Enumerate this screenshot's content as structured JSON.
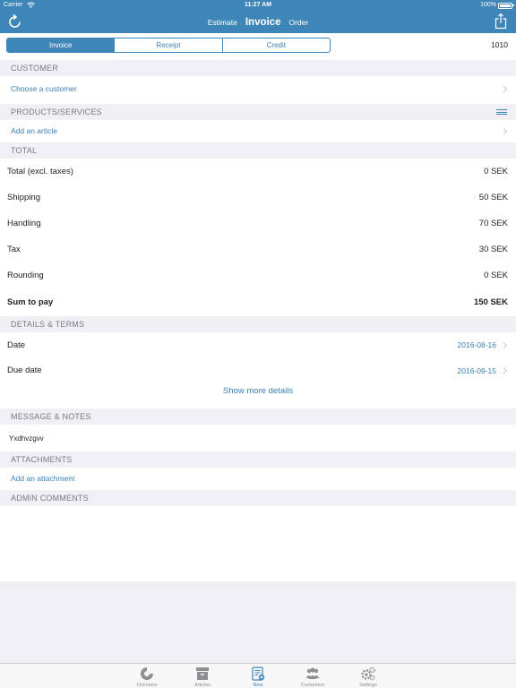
{
  "status_bar": {
    "carrier": "Carrier",
    "time": "11:27 AM",
    "battery": "100%"
  },
  "nav": {
    "tabs": [
      {
        "label": "Estimate"
      },
      {
        "label": "Invoice"
      },
      {
        "label": "Order"
      }
    ]
  },
  "segments": [
    {
      "label": "Invoice"
    },
    {
      "label": "Receipt"
    },
    {
      "label": "Credit"
    }
  ],
  "invoice_number": "1010",
  "customer": {
    "header": "CUSTOMER",
    "choose_label": "Choose a customer"
  },
  "products": {
    "header": "PRODUCTS/SERVICES",
    "add_label": "Add an article"
  },
  "total": {
    "header": "TOTAL",
    "rows": [
      {
        "label": "Total (excl. taxes)",
        "value": "0 SEK"
      },
      {
        "label": "Shipping",
        "value": "50 SEK"
      },
      {
        "label": "Handling",
        "value": "70 SEK"
      },
      {
        "label": "Tax",
        "value": "30 SEK"
      },
      {
        "label": "Rounding",
        "value": "0 SEK"
      },
      {
        "label": "Sum to pay",
        "value": "150 SEK"
      }
    ]
  },
  "details": {
    "header": "DETAILS & TERMS",
    "date_label": "Date",
    "date_value": "2016-08-16",
    "due_label": "Due date",
    "due_value": "2016-09-15",
    "show_more": "Show more details"
  },
  "message": {
    "header": "MESSAGE & NOTES",
    "text": "Yxdhvzgvv"
  },
  "attachments": {
    "header": "ATTACHMENTS",
    "add_label": "Add an attachment"
  },
  "admin_comments": {
    "header": "ADMIN COMMENTS"
  },
  "tab_bar": {
    "items": [
      {
        "label": "Overview"
      },
      {
        "label": "Articles"
      },
      {
        "label": "New"
      },
      {
        "label": "Customers"
      },
      {
        "label": "Settings"
      }
    ]
  },
  "colors": {
    "accent": "#3e86b8",
    "section_bg": "#efeff4",
    "link": "#3b7fb0"
  }
}
